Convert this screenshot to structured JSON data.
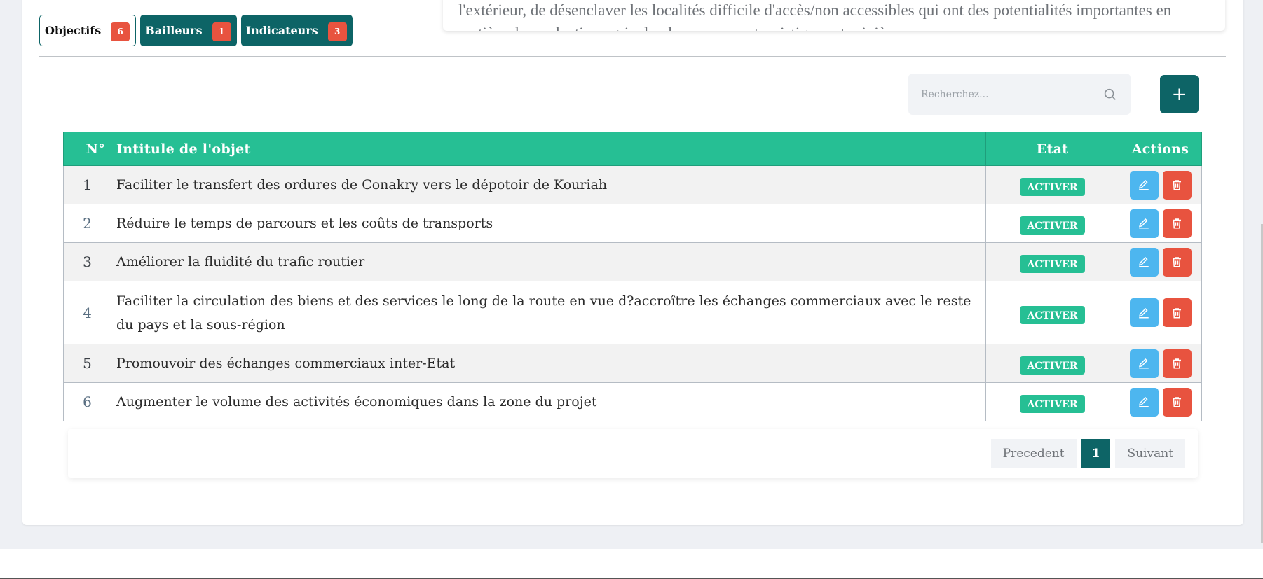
{
  "tabs": [
    {
      "label": "Objectifs",
      "count": "6"
    },
    {
      "label": "Bailleurs",
      "count": "1"
    },
    {
      "label": "Indicateurs",
      "count": "3"
    }
  ],
  "description_text": "l'extérieur, de désenclaver les localités difficile d'accès/non accessibles qui ont des potentialités importantes en matière de production agricole, de ressources touristiques et minières",
  "search": {
    "placeholder": "Recherchez..."
  },
  "add_button": {
    "label": "+"
  },
  "table": {
    "headers": {
      "no": "N°",
      "title": "Intitule de l'objet",
      "etat": "Etat",
      "actions": "Actions"
    },
    "rows": [
      {
        "no": "1",
        "title": "Faciliter le transfert des ordures de Conakry vers le dépotoir de Kouriah",
        "status": "ACTIVER"
      },
      {
        "no": "2",
        "title": "Réduire le temps de parcours et les coûts de transports",
        "status": "ACTIVER"
      },
      {
        "no": "3",
        "title": "Améliorer la fluidité du trafic routier",
        "status": "ACTIVER"
      },
      {
        "no": "4",
        "title": "Faciliter la circulation des biens et des services le long de la route en vue d?accroître les échanges commerciaux avec le reste du pays et la sous-région",
        "status": "ACTIVER"
      },
      {
        "no": "5",
        "title": "Promouvoir des échanges commerciaux inter-Etat",
        "status": "ACTIVER"
      },
      {
        "no": "6",
        "title": "Augmenter le volume des activités économiques dans la zone du projet",
        "status": "ACTIVER"
      }
    ]
  },
  "pagination": {
    "prev": "Precedent",
    "current": "1",
    "next": "Suivant"
  },
  "colors": {
    "primary": "#0d6466",
    "accent": "#26bf94",
    "badge": "#e8533f",
    "edit": "#4db6ef",
    "delete": "#e8533f"
  }
}
